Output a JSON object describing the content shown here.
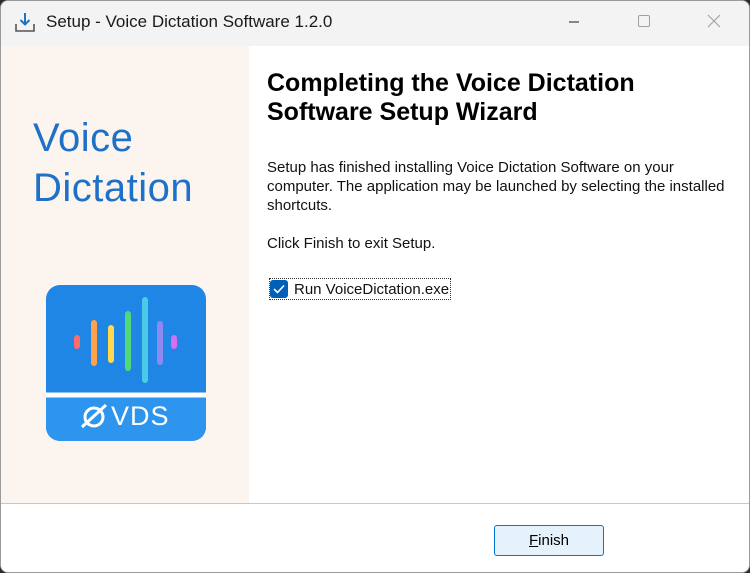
{
  "window": {
    "title": "Setup - Voice Dictation Software 1.2.0",
    "icons": [
      "installer-icon",
      "minimize-icon",
      "maximize-icon",
      "close-icon"
    ]
  },
  "side_panel": {
    "brand_line1": "Voice",
    "brand_line2": "Dictation",
    "logo_text": "VDS",
    "brand_color": "#1e71c8",
    "logo_color": "#1f86e6"
  },
  "content": {
    "heading": "Completing the Voice Dictation Software Setup Wizard",
    "paragraph1": "Setup has finished installing Voice Dictation Software on your computer. The application may be launched by selecting the installed shortcuts.",
    "paragraph2": "Click Finish to exit Setup.",
    "run_checkbox": {
      "label": "Run VoiceDictation.exe",
      "checked": true
    }
  },
  "footer": {
    "finish_accel": "F",
    "finish_rest": "inish"
  }
}
